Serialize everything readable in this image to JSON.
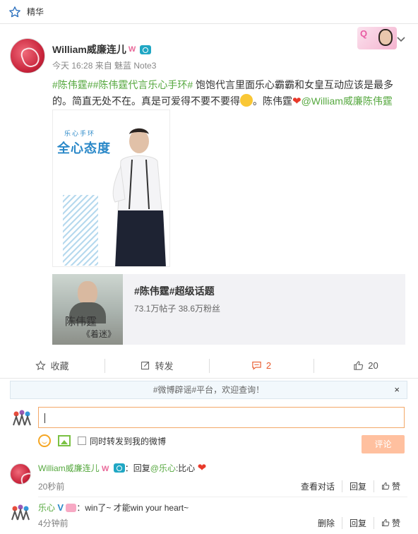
{
  "topbar": {
    "label": "精华"
  },
  "post": {
    "username": "William威廉连儿",
    "meta": "今天 16:28 来自 魅蓝 Note3",
    "topic1": "#陈伟霆#",
    "topic2": "#陈伟霆代言乐心手环#",
    "text_a": " 饱饱代言里面乐心霸霸和女皇互动应该是最多的。简直无处不在。真是可爱得不要不要得",
    "text_b": "。陈伟霆",
    "mention": "@William威廉陈伟霆",
    "poster": {
      "tag": "乐心手环",
      "headline": "全心态度"
    },
    "topic_card": {
      "title": "#陈伟霆#超级话题",
      "stats": "73.1万帖子 38.6万粉丝",
      "thumb_line1": "陈伟霆",
      "thumb_line2": "《着迷》"
    }
  },
  "actions": {
    "favorite": "收藏",
    "repost": "转发",
    "comment": "2",
    "like": "20"
  },
  "notice": {
    "text": "#微博辟谣#平台，欢迎查询！",
    "close": "×"
  },
  "composer": {
    "checkbox_label": "同时转发到我的微博",
    "submit": "评论"
  },
  "comments": [
    {
      "name": "William威廉连儿",
      "text": "：回复",
      "mention": "@乐心",
      "text2": ":比心",
      "time": "20秒前",
      "op1": "查看对话",
      "op2": "回复",
      "op3": "赞"
    },
    {
      "name": "乐心",
      "text": "：win了~ 才能win your heart~",
      "time": "4分钟前",
      "op1": "删除",
      "op2": "回复",
      "op3": "赞"
    }
  ],
  "colors": {
    "accent": "#56a83f",
    "orange": "#e8592b",
    "submit": "#ffc09f"
  }
}
